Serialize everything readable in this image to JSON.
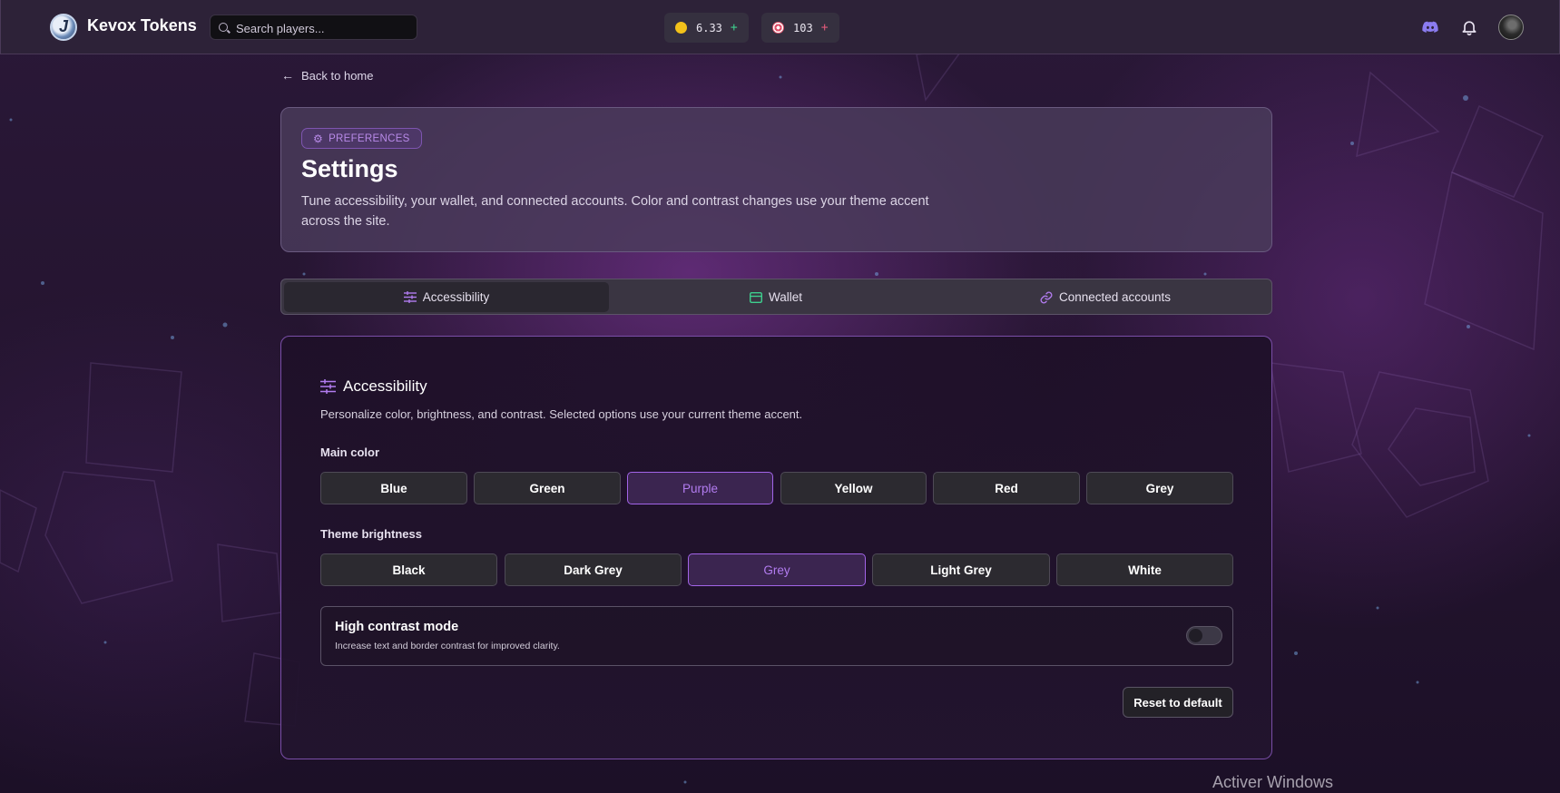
{
  "header": {
    "brand": "Kevox Tokens",
    "logo_letter": "J",
    "search_placeholder": "Search players...",
    "coins": {
      "value": "6.33",
      "plus": "+"
    },
    "targets": {
      "value": "103",
      "plus": "+"
    }
  },
  "nav": {
    "back_label": "Back to home"
  },
  "hero": {
    "chip": "PREFERENCES",
    "title": "Settings",
    "description": "Tune accessibility, your wallet, and connected accounts. Color and contrast changes use your theme accent across the site."
  },
  "tabs": [
    {
      "label": "Accessibility",
      "active": true
    },
    {
      "label": "Wallet",
      "active": false
    },
    {
      "label": "Connected accounts",
      "active": false
    }
  ],
  "accessibility": {
    "title": "Accessibility",
    "description": "Personalize color, brightness, and contrast. Selected options use your current theme accent.",
    "main_color": {
      "label": "Main color",
      "options": [
        "Blue",
        "Green",
        "Purple",
        "Yellow",
        "Red",
        "Grey"
      ],
      "selected": "Purple"
    },
    "theme_brightness": {
      "label": "Theme brightness",
      "options": [
        "Black",
        "Dark Grey",
        "Grey",
        "Light Grey",
        "White"
      ],
      "selected": "Grey"
    },
    "high_contrast": {
      "title": "High contrast mode",
      "description": "Increase text and border contrast for improved clarity.",
      "enabled": false
    },
    "reset_label": "Reset to default"
  },
  "watermark": "Activer Windows",
  "colors": {
    "accent": "#a264e8",
    "wallet_icon": "#3ecf8e",
    "discord": "#8b7cf0"
  }
}
